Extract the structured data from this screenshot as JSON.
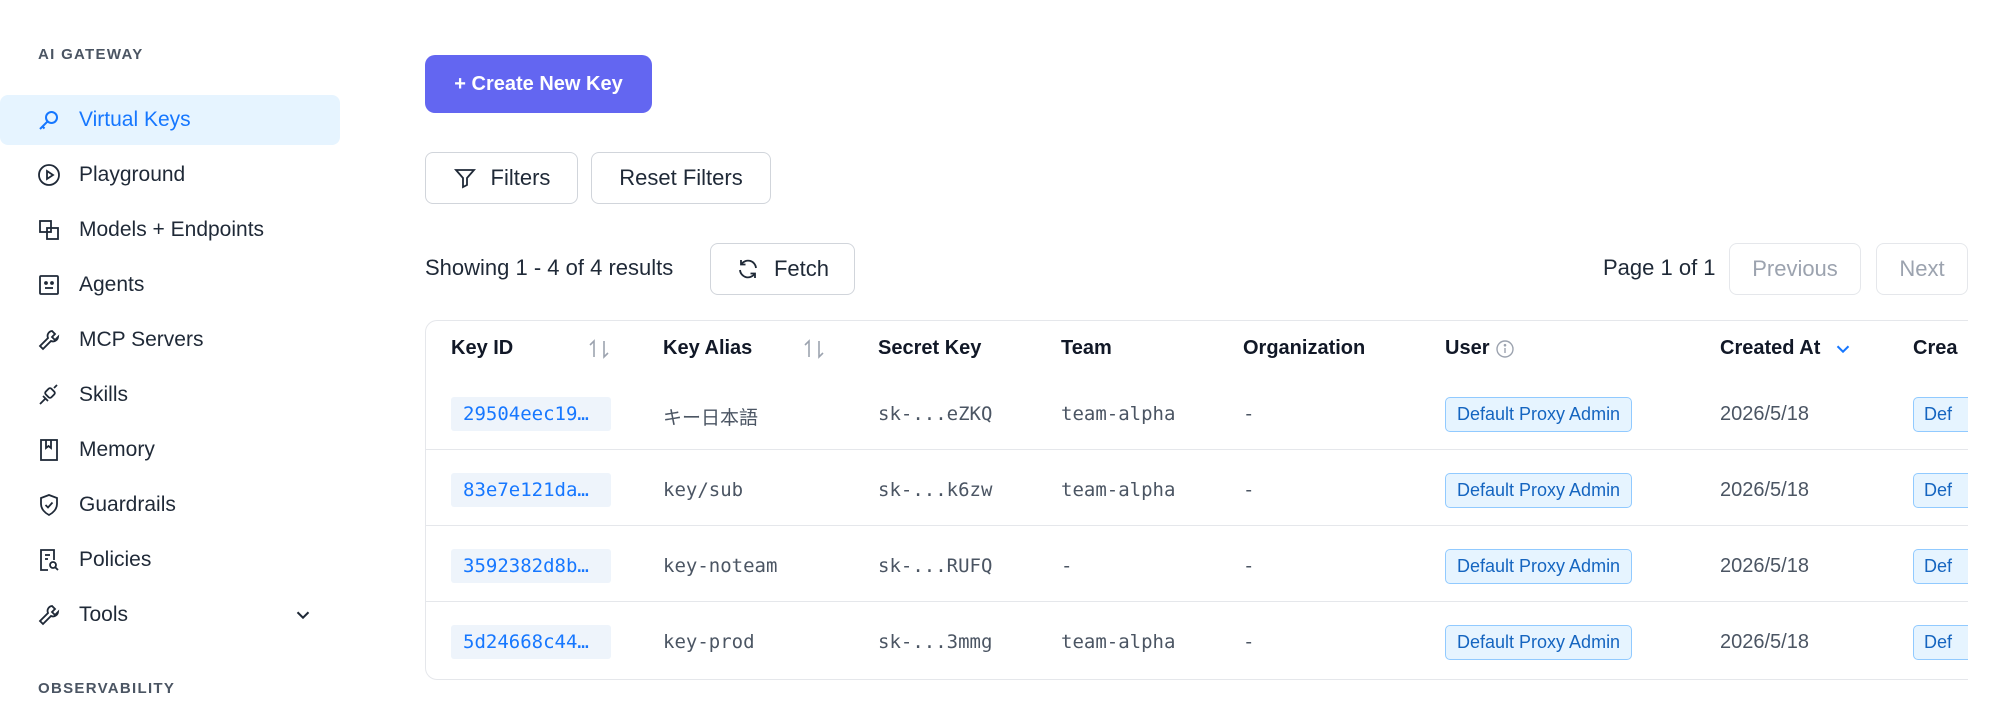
{
  "sidebar": {
    "section_gateway": "AI GATEWAY",
    "section_observability": "OBSERVABILITY",
    "items": [
      {
        "label": "Virtual Keys",
        "icon": "key-icon",
        "active": true
      },
      {
        "label": "Playground",
        "icon": "play-circle-icon"
      },
      {
        "label": "Models + Endpoints",
        "icon": "block-icon"
      },
      {
        "label": "Agents",
        "icon": "robot-icon"
      },
      {
        "label": "MCP Servers",
        "icon": "tool-icon"
      },
      {
        "label": "Skills",
        "icon": "api-icon"
      },
      {
        "label": "Memory",
        "icon": "book-icon"
      },
      {
        "label": "Guardrails",
        "icon": "safety-icon"
      },
      {
        "label": "Policies",
        "icon": "audit-icon"
      },
      {
        "label": "Tools",
        "icon": "tool-icon"
      }
    ]
  },
  "toolbar": {
    "create_label": "+ Create New Key",
    "filters_label": "Filters",
    "reset_label": "Reset Filters",
    "fetch_label": "Fetch",
    "results_text": "Showing 1 - 4 of 4 results",
    "page_text": "Page 1 of 1",
    "previous_label": "Previous",
    "next_label": "Next"
  },
  "table": {
    "headers": {
      "key_id": "Key ID",
      "key_alias": "Key Alias",
      "secret_key": "Secret Key",
      "team": "Team",
      "organization": "Organization",
      "user": "User",
      "created_at": "Created At",
      "created_by": "Crea"
    },
    "rows": [
      {
        "key_id": "29504eec19…",
        "alias": "キー日本語",
        "secret": "sk-...eZKQ",
        "team": "team-alpha",
        "org": "-",
        "user": "Default Proxy Admin",
        "created_at": "2026/5/18",
        "created_by": "Def"
      },
      {
        "key_id": "83e7e121da…",
        "alias": "key/sub",
        "secret": "sk-...k6zw",
        "team": "team-alpha",
        "org": "-",
        "user": "Default Proxy Admin",
        "created_at": "2026/5/18",
        "created_by": "Def"
      },
      {
        "key_id": "3592382d8b…",
        "alias": "key-noteam",
        "secret": "sk-...RUFQ",
        "team": "-",
        "org": "-",
        "user": "Default Proxy Admin",
        "created_at": "2026/5/18",
        "created_by": "Def"
      },
      {
        "key_id": "5d24668c44…",
        "alias": "key-prod",
        "secret": "sk-...3mmg",
        "team": "team-alpha",
        "org": "-",
        "user": "Default Proxy Admin",
        "created_at": "2026/5/18",
        "created_by": "Def"
      }
    ]
  },
  "colors": {
    "primary": "#6366f1",
    "accent": "#1677ff",
    "active_bg": "#e6f4ff"
  }
}
